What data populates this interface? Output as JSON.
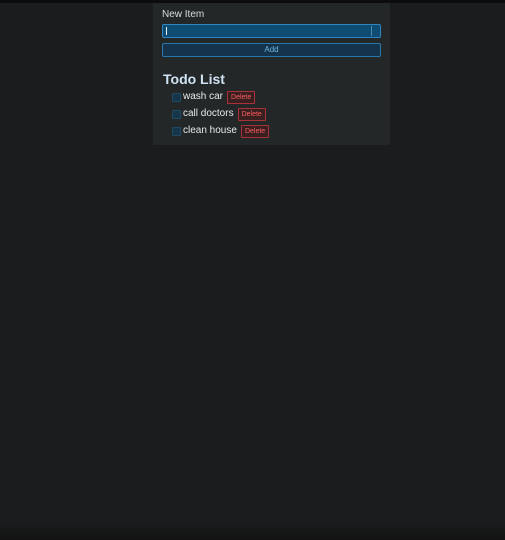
{
  "form": {
    "label": "New Item",
    "input_value": "",
    "add_label": "Add"
  },
  "todo": {
    "title": "Todo List",
    "items": [
      {
        "text": "wash car",
        "delete_label": "Delete"
      },
      {
        "text": "call doctors",
        "delete_label": "Delete"
      },
      {
        "text": "clean house",
        "delete_label": "Delete"
      }
    ]
  },
  "colors": {
    "page_background": "#1b1c1d",
    "panel_background": "#242727",
    "input_background": "#0f4c73",
    "accent_blue": "#2f86be",
    "delete_red": "#ff5e5e"
  }
}
